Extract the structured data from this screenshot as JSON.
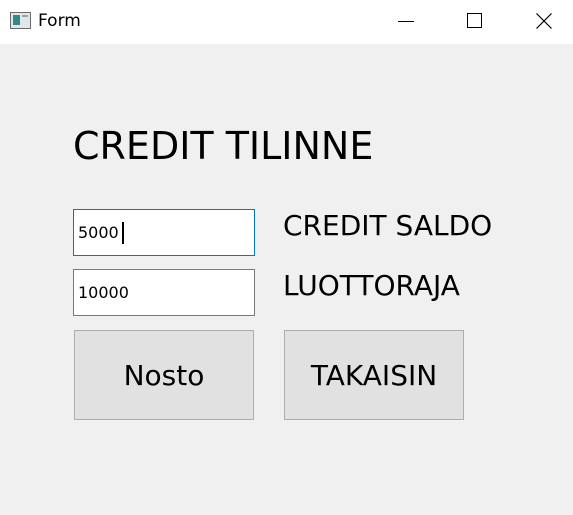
{
  "window": {
    "title": "Form",
    "controls": [
      "minimize-icon",
      "maximize-icon",
      "close-icon"
    ]
  },
  "form": {
    "heading": "CREDIT TILINNE",
    "credit_saldo_value": "5000",
    "credit_saldo_label": "CREDIT SALDO",
    "luottoraja_value": "10000",
    "luottoraja_label": "LUOTTORAJA",
    "nosto_button": "Nosto",
    "takaisin_button": "TAKAISIN"
  },
  "colors": {
    "background": "#f0f0f0",
    "titlebar": "#ffffff",
    "focus_border": "#0078d7",
    "button_face": "#e1e1e1"
  }
}
